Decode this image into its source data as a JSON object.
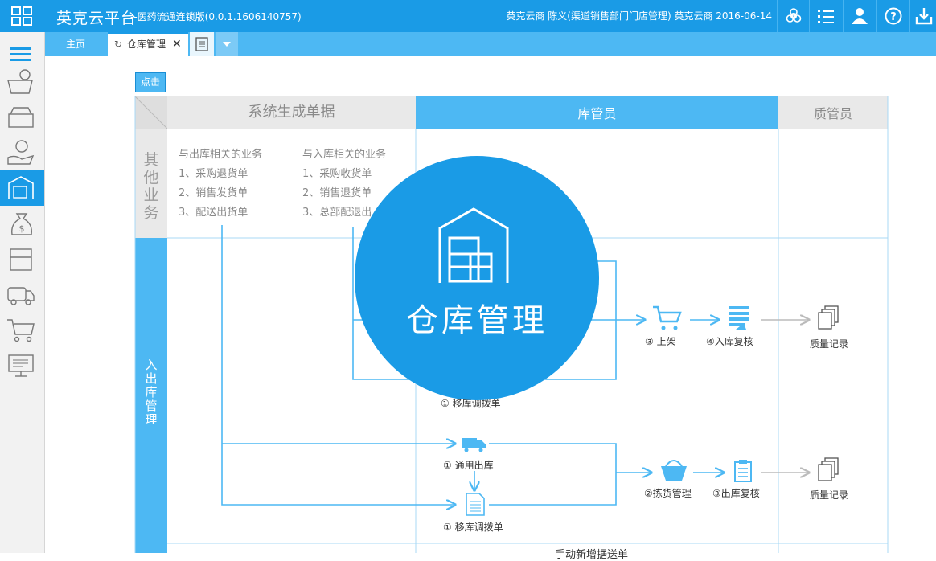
{
  "header": {
    "brand": "英克云平台",
    "subtitle": "--医药流通连锁版(0.0.1.1606140757)",
    "user_info": "英克云商  陈义(渠道销售部门门店管理)  英克云商   2016-06-14",
    "icons": [
      "biohazard-icon",
      "list-icon",
      "user-icon",
      "help-icon",
      "download-icon"
    ]
  },
  "tabs": {
    "home": "主页",
    "active": "仓库管理"
  },
  "toolbar": {
    "click_label": "点击"
  },
  "table": {
    "header_system": "系统生成单据",
    "header_warehouse": "库管员",
    "header_quality": "质管员",
    "row_other": "其他业务",
    "row_inout": "入出库管理"
  },
  "business": {
    "out_title": "与出库相关的业务",
    "out_items": [
      "1、采购退货单",
      "2、销售发货单",
      "3、配送出货单"
    ],
    "in_title": "与入库相关的业务",
    "in_items": [
      "1、采购收货单",
      "2、销售退货单",
      "3、总部配退出"
    ]
  },
  "flow": {
    "in": {
      "shelve": "③ 上架",
      "recheck": "④入库复核",
      "quality": "质量记录",
      "transfer": "① 移库调拨单"
    },
    "out": {
      "general": "① 通用出库",
      "transfer": "① 移库调拨单",
      "pick": "②拣货管理",
      "recheck": "③出库复核",
      "quality": "质量记录"
    },
    "bottom_cut": "手动新增据送单"
  },
  "overlay": {
    "title": "仓库管理"
  },
  "colors": {
    "primary": "#1a9be6",
    "light": "#4db8f3",
    "line": "#4db8f3"
  }
}
